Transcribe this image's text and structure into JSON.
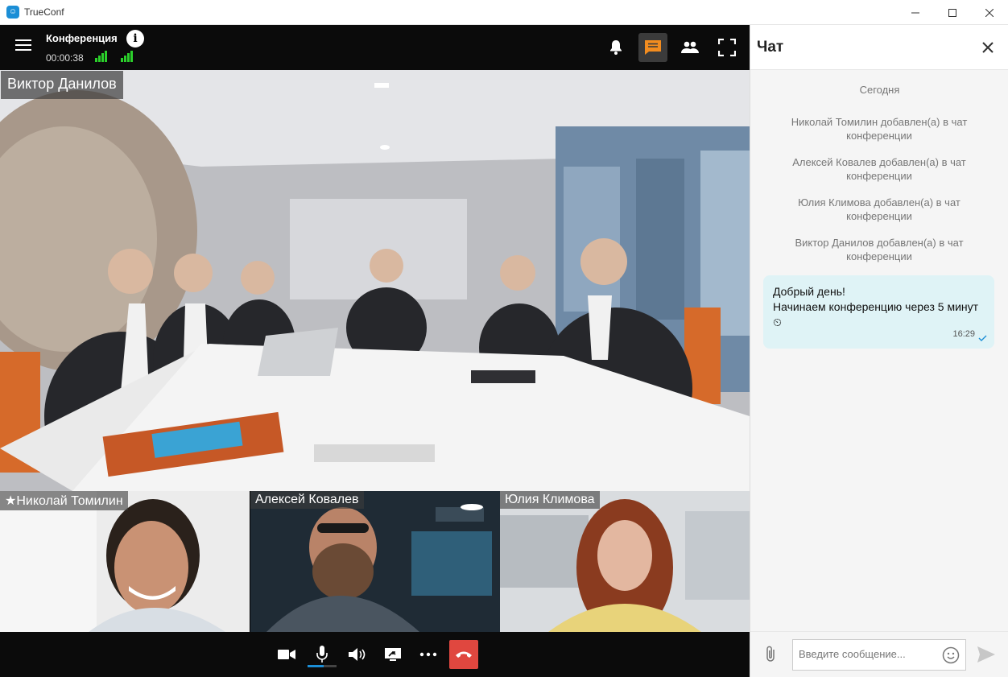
{
  "window": {
    "app_title": "TrueConf",
    "app_icon": "trueconf-logo-icon"
  },
  "topbar": {
    "conference_title": "Конференция",
    "timer": "00:00:38",
    "icons": [
      "menu-icon",
      "info-icon",
      "signal-icon",
      "bell-icon",
      "chat-icon",
      "participants-icon",
      "fullscreen-icon"
    ]
  },
  "main_video": {
    "speaker_name": "Виктор Данилов"
  },
  "tiles": [
    {
      "name": "Николай Томилин",
      "star": "★"
    },
    {
      "name": "Алексей Ковалев"
    },
    {
      "name": "Юлия Климова"
    }
  ],
  "bottombar": {
    "icons": [
      "camera-icon",
      "microphone-icon",
      "speaker-icon",
      "screen-share-icon",
      "more-icon",
      "hangup-icon"
    ],
    "mic_level": 0.55
  },
  "chat": {
    "title": "Чат",
    "date_label": "Сегодня",
    "system_messages": [
      "Николай Томилин добавлен(а) в чат конференции",
      "Алексей Ковалев добавлен(а) в чат конференции",
      "Юлия Климова добавлен(а) в чат конференции",
      "Виктор Данилов добавлен(а) в чат конференции"
    ],
    "message": {
      "line1": "Добрый день!",
      "line2": "Начинаем конференцию через 5 минут",
      "emoji": "⏲",
      "time": "16:29"
    },
    "input_placeholder": "Введите сообщение..."
  },
  "colors": {
    "accent_blue": "#1b8ed6",
    "active_chat_button": "#f28c1f",
    "hangup_red": "#e0473f",
    "signal_green": "#2bd02b",
    "bubble_bg": "#dff3f6"
  }
}
